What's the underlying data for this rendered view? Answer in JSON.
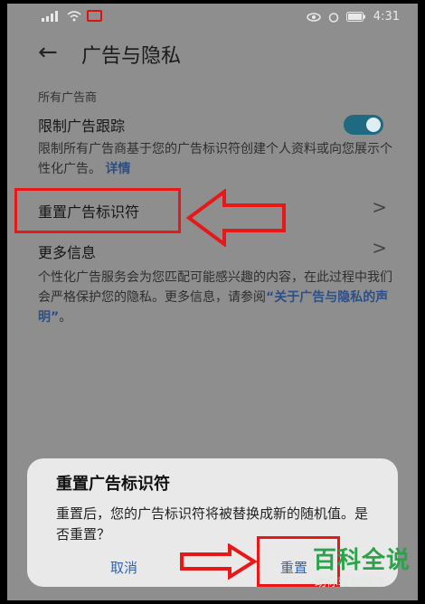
{
  "status": {
    "time": "4:31"
  },
  "header": {
    "back_icon": "←",
    "title": "广告与隐私"
  },
  "section": {
    "label": "所有广告商"
  },
  "limit_tracking": {
    "title": "限制广告跟踪",
    "enabled": true,
    "desc": "限制所有广告商基于您的广告标识符创建个人资料或向您展示个性化广告。",
    "link": "详情"
  },
  "reset_id": {
    "title": "重置广告标识符",
    "chevron": ">"
  },
  "more_info": {
    "title": "更多信息",
    "chevron": ">",
    "desc": "个性化广告服务会为您匹配可能感兴趣的内容，在此过程中我们会严格保护您的隐私。更多信息，请参阅",
    "link": "“关于广告与隐私的声明”",
    "desc_end": "。"
  },
  "dialog": {
    "title": "重置广告标识符",
    "body": "重置后，您的广告标识符将被替换成新的随机值。是否重置？",
    "cancel": "取消",
    "confirm": "重置"
  },
  "watermark": {
    "main": "百科全说",
    "sub": "助你轻松解决"
  },
  "colors": {
    "highlight": "#e81818",
    "accent": "#1f6a80",
    "link": "#2b64b8"
  }
}
